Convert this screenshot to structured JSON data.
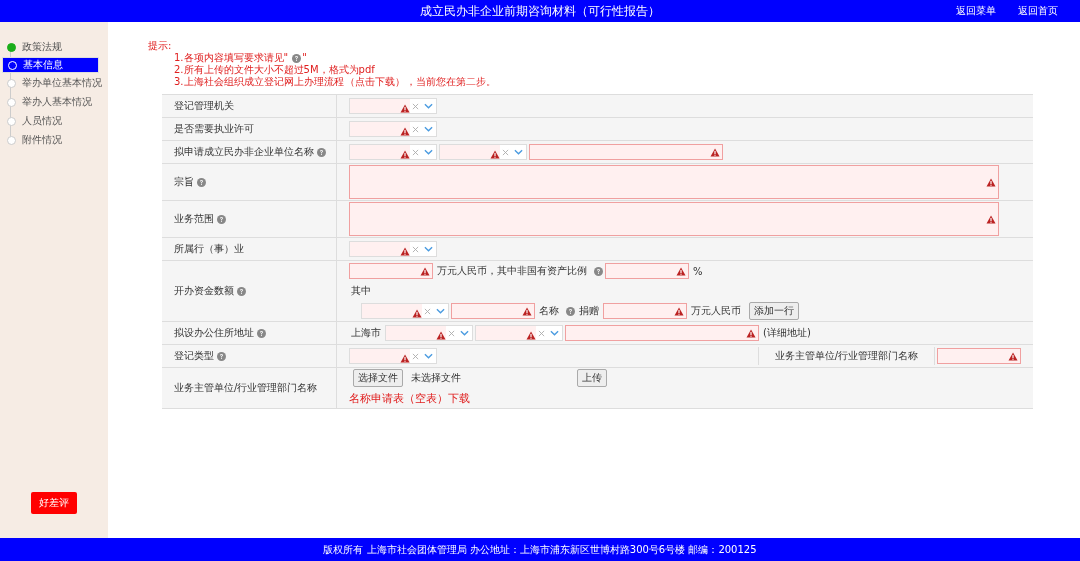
{
  "header": {
    "title": "成立民办非企业前期咨询材料（可行性报告）",
    "links": [
      "返回菜单",
      "返回首页"
    ]
  },
  "steps": [
    {
      "label": "政策法规",
      "done": true,
      "selected": false
    },
    {
      "label": "基本信息",
      "done": false,
      "selected": true
    },
    {
      "label": "举办单位基本情况",
      "done": false,
      "selected": false
    },
    {
      "label": "举办人基本情况",
      "done": false,
      "selected": false
    },
    {
      "label": "人员情况",
      "done": false,
      "selected": false
    },
    {
      "label": "附件情况",
      "done": false,
      "selected": false
    }
  ],
  "rating_button": "好差评",
  "tips": {
    "title": "提示:",
    "items": [
      {
        "text": "1.各项内容填写要求请见\"",
        "help": true,
        "after": "\""
      },
      {
        "text": "2.所有上传的文件大小不超过5M，格式为pdf"
      },
      {
        "text": "3.上海社会组织成立登记网上办理流程",
        "link": "（点击下载）",
        "after": "，当前您在第二步。"
      }
    ]
  },
  "rows": [
    {
      "label": "登记管理机关",
      "help": false,
      "lines": [
        [
          {
            "kind": "select",
            "invalid": true
          }
        ]
      ]
    },
    {
      "label": "是否需要执业许可",
      "help": false,
      "lines": [
        [
          {
            "kind": "select",
            "invalid": true
          }
        ]
      ]
    },
    {
      "label": "拟申请成立民办非企业单位名称",
      "help": true,
      "lines": [
        [
          {
            "kind": "select",
            "invalid": true
          },
          {
            "kind": "select",
            "invalid": true
          },
          {
            "kind": "input",
            "wide": true,
            "invalid": true
          }
        ]
      ]
    },
    {
      "label": "宗旨",
      "help": true,
      "lines": [
        [
          {
            "kind": "textarea",
            "invalid": true
          }
        ]
      ]
    },
    {
      "label": "业务范围",
      "help": true,
      "lines": [
        [
          {
            "kind": "textarea",
            "invalid": true
          }
        ]
      ]
    },
    {
      "label": "所属行（事）业",
      "help": false,
      "lines": [
        [
          {
            "kind": "select",
            "invalid": true
          }
        ]
      ]
    },
    {
      "label": "开办资金数额",
      "help": true,
      "lines": [
        [
          {
            "kind": "input",
            "wide": false,
            "invalid": true
          },
          {
            "kind": "text",
            "text": "万元人民币，其中非国有资产比例"
          },
          {
            "kind": "help"
          },
          {
            "kind": "input",
            "wide": false,
            "invalid": true
          },
          {
            "kind": "text",
            "text": "%"
          }
        ],
        [
          {
            "kind": "text",
            "text": "其中"
          }
        ],
        [
          {
            "kind": "spacer"
          },
          {
            "kind": "select",
            "invalid": true
          },
          {
            "kind": "input",
            "wide": false,
            "invalid": true
          },
          {
            "kind": "text",
            "text": "名称"
          },
          {
            "kind": "help"
          },
          {
            "kind": "text",
            "text": "捐赠"
          },
          {
            "kind": "input",
            "wide": false,
            "invalid": true
          },
          {
            "kind": "text",
            "text": "万元人民币"
          },
          {
            "kind": "button",
            "text": "添加一行"
          }
        ]
      ]
    },
    {
      "label": "拟设办公住所地址",
      "help": true,
      "lines": [
        [
          {
            "kind": "text",
            "text": "上海市"
          },
          {
            "kind": "select",
            "invalid": true
          },
          {
            "kind": "select",
            "invalid": true
          },
          {
            "kind": "input",
            "wide": true,
            "invalid": true
          },
          {
            "kind": "text",
            "text": "(详细地址)"
          }
        ]
      ]
    },
    {
      "label": "登记类型",
      "help": true,
      "lines": [
        [
          {
            "kind": "select",
            "invalid": true
          },
          {
            "kind": "sublabel",
            "text": "业务主管单位/行业管理部门名称"
          },
          {
            "kind": "input",
            "wide": false,
            "invalid": true
          }
        ]
      ]
    },
    {
      "label": "业务主管单位/行业管理部门名称",
      "help": false,
      "lines": [
        [
          {
            "kind": "file",
            "button": "选择文件",
            "text": "未选择文件"
          },
          {
            "kind": "button",
            "text": "上传"
          }
        ],
        [
          {
            "kind": "note",
            "text": "名称申请表（空表）下载"
          }
        ]
      ]
    }
  ],
  "footer": "版权所有 上海市社会团体管理局 办公地址：上海市浦东新区世博村路300号6号楼 邮编：200125"
}
